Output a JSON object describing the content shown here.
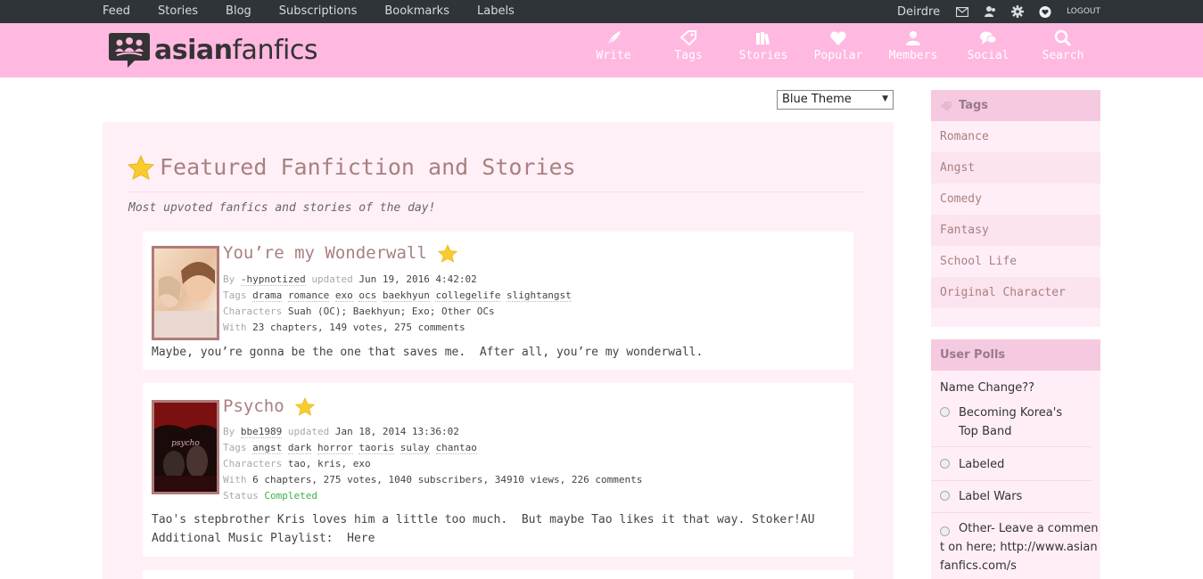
{
  "topbar": {
    "links": [
      "Feed",
      "Stories",
      "Blog",
      "Subscriptions",
      "Bookmarks",
      "Labels"
    ],
    "username": "Deirdre",
    "icons": [
      "mail-icon",
      "friends-icon",
      "gear-icon",
      "heart-globe-icon"
    ],
    "logout": "LOGOUT"
  },
  "header": {
    "logo_bold": "asian",
    "logo_light": "fanfics",
    "nav": [
      {
        "label": "Write",
        "icon": "quill-icon"
      },
      {
        "label": "Tags",
        "icon": "tag-icon"
      },
      {
        "label": "Stories",
        "icon": "books-icon"
      },
      {
        "label": "Popular",
        "icon": "heart-icon"
      },
      {
        "label": "Members",
        "icon": "member-icon"
      },
      {
        "label": "Social",
        "icon": "chat-icon"
      },
      {
        "label": "Search",
        "icon": "search-icon"
      }
    ]
  },
  "theme": {
    "selected": "Blue Theme"
  },
  "featured": {
    "title": "Featured Fanfiction and Stories",
    "subtitle": "Most upvoted fanfics and stories of the day!"
  },
  "stories": [
    {
      "title": "You’re my Wonderwall",
      "by_label": "By",
      "author": "-hypnotized",
      "updated_label": "updated",
      "updated": "Jun 19, 2016 4:42:02",
      "tags_label": "Tags",
      "tags": [
        "drama",
        "romance",
        "exo",
        "ocs",
        "baekhyun",
        "collegelife",
        "slightangst"
      ],
      "chars_label": "Characters",
      "characters": "Suah (OC); Baekhyun; Exo; Other OCs",
      "with_label": "With",
      "chapters": "23",
      "chapters_label": "chapters,",
      "votes": "149",
      "votes_label": "votes,",
      "comments": "275",
      "comments_label": "comments",
      "description": "Maybe, you’re gonna be the one that saves me.  After all, you’re my wonderwall."
    },
    {
      "title": "Psycho",
      "by_label": "By",
      "author": "bbe1989",
      "updated_label": "updated",
      "updated": "Jan 18, 2014 13:36:02",
      "tags_label": "Tags",
      "tags": [
        "angst",
        "dark",
        "horror",
        "taoris",
        "sulay",
        "chantao"
      ],
      "chars_label": "Characters",
      "characters": "tao, kris, exo",
      "with_label": "With",
      "chapters": "6",
      "chapters_label": "chapters,",
      "votes": "275",
      "votes_label": "votes,",
      "subscribers": "1040",
      "subscribers_label": "subscribers,",
      "views": "34910",
      "views_label": "views,",
      "comments": "226",
      "comments_label": "comments",
      "status_label": "Status",
      "status": "Completed",
      "cover_text": "psycho",
      "description_line1": "Tao's stepbrother Kris loves him a little too much.  But maybe Tao likes it that way. Stoker!AU",
      "description_line2": "Additional Music Playlist:  Here"
    }
  ],
  "sidebar": {
    "tags_title": "Tags",
    "tags": [
      "Romance",
      "Angst",
      "Comedy",
      "Fantasy",
      "School Life",
      "Original Character"
    ],
    "polls_title": "User Polls",
    "poll_question": "Name Change??",
    "poll_options": [
      "Becoming Korea's Top Band",
      "Labeled",
      "Label Wars",
      "Other- Leave a comment on here; http://www.asianfanfics.com/s"
    ]
  }
}
